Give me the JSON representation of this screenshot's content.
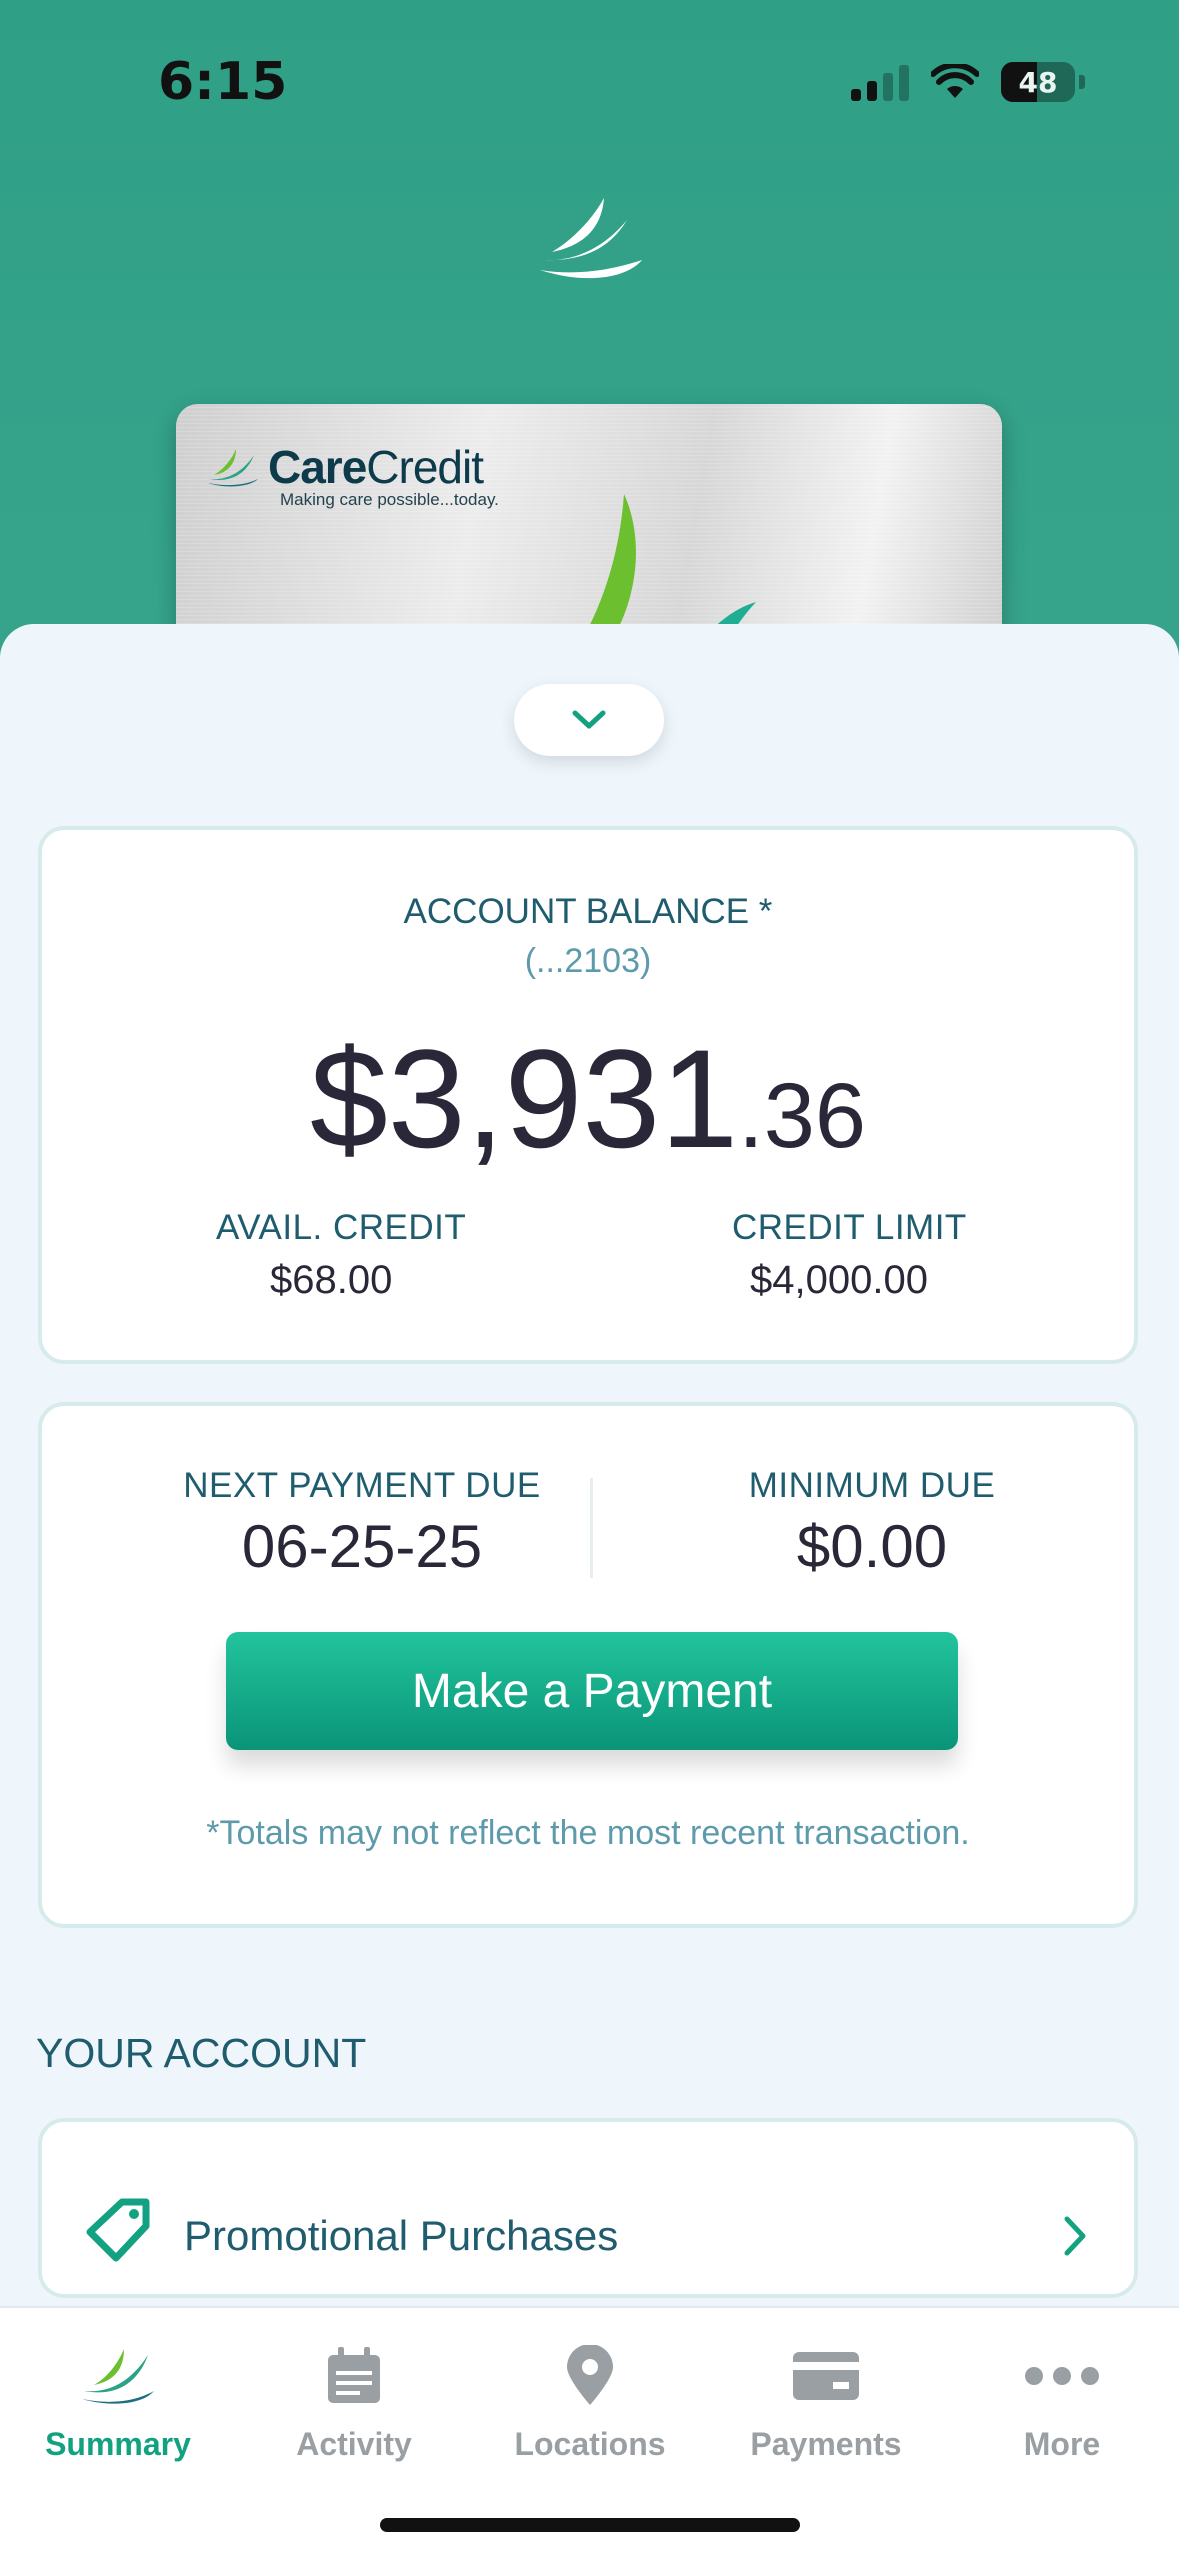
{
  "status_bar": {
    "time": "6:15",
    "battery": "48"
  },
  "card": {
    "brand_bold": "Care",
    "brand_light": "Credit",
    "tagline": "Making care possible...today."
  },
  "balance": {
    "title": "ACCOUNT BALANCE *",
    "account": "(...2103)",
    "amount_main": "$3,931",
    "amount_cents": ".36",
    "avail_label": "AVAIL. CREDIT",
    "avail_value": "$68.00",
    "limit_label": "CREDIT LIMIT",
    "limit_value": "$4,000.00"
  },
  "payment": {
    "due_label": "NEXT PAYMENT DUE",
    "due_value": "06-25-25",
    "min_label": "MINIMUM DUE",
    "min_value": "$0.00",
    "button_label": "Make a Payment",
    "disclaimer": "*Totals may not reflect the most recent transaction."
  },
  "account_section": {
    "title": "YOUR ACCOUNT",
    "items": [
      {
        "label": "Promotional Purchases",
        "icon": "tag-icon"
      }
    ]
  },
  "tabs": [
    {
      "label": "Summary",
      "icon": "summary-logo-icon",
      "active": true
    },
    {
      "label": "Activity",
      "icon": "calendar-icon",
      "active": false
    },
    {
      "label": "Locations",
      "icon": "location-pin-icon",
      "active": false
    },
    {
      "label": "Payments",
      "icon": "credit-card-icon",
      "active": false
    },
    {
      "label": "More",
      "icon": "more-dots-icon",
      "active": false
    }
  ],
  "colors": {
    "accent": "#13a281",
    "header": "#2f9f86",
    "text_teal": "#1f5c6e",
    "text_dark": "#2a2738"
  }
}
